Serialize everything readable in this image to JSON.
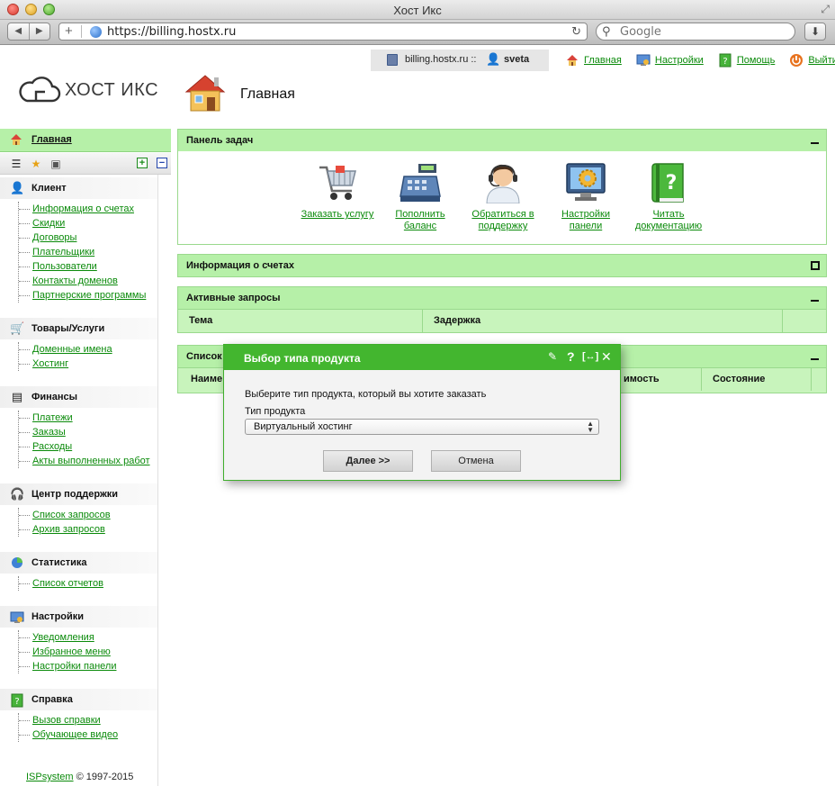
{
  "browser": {
    "window_title": "Хост Икс",
    "url": "https://billing.hostx.ru",
    "search_placeholder": "Google"
  },
  "header": {
    "server": "billing.hostx.ru ::",
    "user": "sveta",
    "links": [
      {
        "label": "Главная",
        "icon": "home-icon"
      },
      {
        "label": "Настройки",
        "icon": "settings-icon"
      },
      {
        "label": "Помощь",
        "icon": "help-icon"
      },
      {
        "label": "Выйти",
        "icon": "power-icon"
      }
    ],
    "brand": "ХОСТ ИКС",
    "page_title": "Главная"
  },
  "sidebar": {
    "main": "Главная",
    "groups": [
      {
        "title": "Клиент",
        "icon": "client-icon",
        "items": [
          "Информация о счетах",
          "Скидки",
          "Договоры",
          "Плательщики",
          "Пользователи",
          "Контакты доменов",
          "Партнерские программы"
        ]
      },
      {
        "title": "Товары/Услуги",
        "icon": "cart-icon",
        "items": [
          "Доменные имена",
          "Хостинг"
        ]
      },
      {
        "title": "Финансы",
        "icon": "finance-icon",
        "items": [
          "Платежи",
          "Заказы",
          "Расходы",
          "Акты выполненных работ"
        ]
      },
      {
        "title": "Центр поддержки",
        "icon": "headset-icon",
        "items": [
          "Список запросов",
          "Архив запросов"
        ]
      },
      {
        "title": "Статистика",
        "icon": "pie-chart-icon",
        "items": [
          "Список отчетов"
        ]
      },
      {
        "title": "Настройки",
        "icon": "settings-icon",
        "items": [
          "Уведомления",
          "Избранное меню",
          "Настройки панели"
        ]
      },
      {
        "title": "Справка",
        "icon": "help-icon",
        "items": [
          "Вызов справки",
          "Обучающее видео"
        ]
      }
    ],
    "copyright_link": "ISPsystem",
    "copyright_text": " © 1997-2015"
  },
  "tasks_panel": {
    "title": "Панель задач",
    "tasks": [
      {
        "label": "Заказать услугу",
        "icon": "cart-icon"
      },
      {
        "label": "Пополнить баланс",
        "icon": "cash-register-icon"
      },
      {
        "label": "Обратиться в поддержку",
        "icon": "support-agent-icon"
      },
      {
        "label": "Настройки панели",
        "icon": "monitor-gear-icon"
      },
      {
        "label": "Читать документацию",
        "icon": "book-icon"
      }
    ]
  },
  "accounts_panel": {
    "title": "Информация о счетах"
  },
  "requests_panel": {
    "title": "Активные запросы",
    "columns": [
      "Тема",
      "Задержка"
    ]
  },
  "list_panel": {
    "title": "Список",
    "columns": [
      "Наиме",
      "имость",
      "Состояние"
    ]
  },
  "modal": {
    "title": "Выбор типа продукта",
    "prompt": "Выберите тип продукта, который вы хотите заказать",
    "field_label": "Тип продукта",
    "selected": "Виртуальный хостинг",
    "next_label": "Далее >>",
    "cancel_label": "Отмена"
  }
}
